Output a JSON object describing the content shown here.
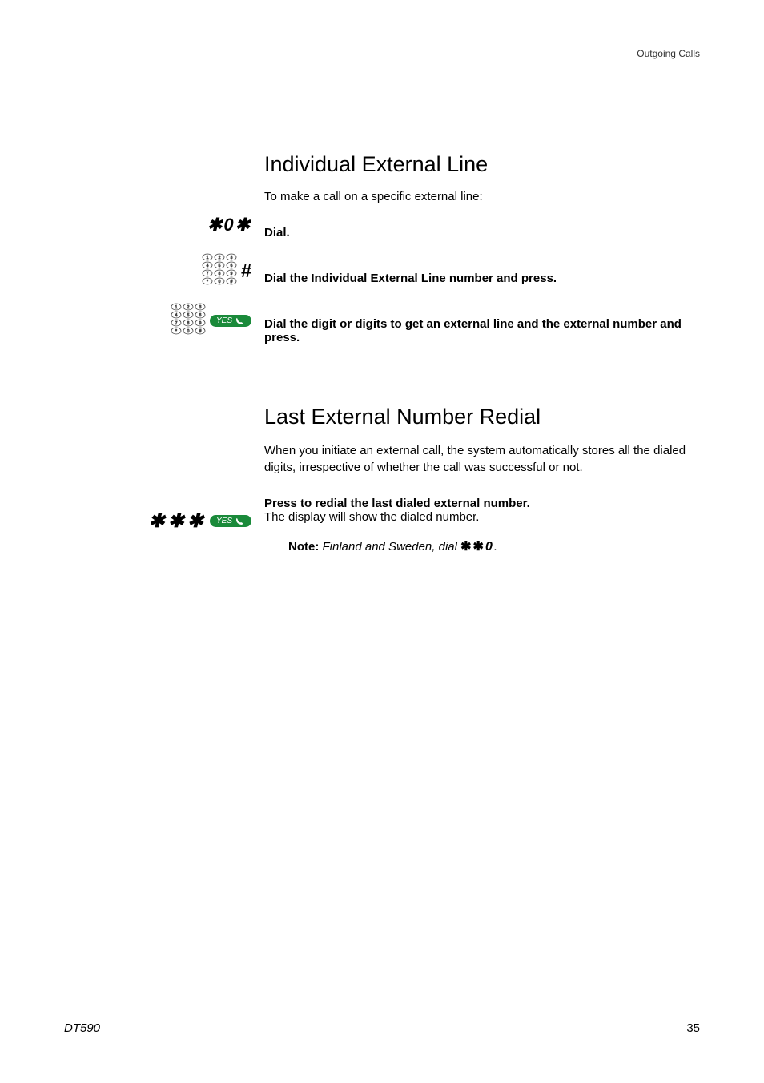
{
  "header": {
    "section_name": "Outgoing Calls"
  },
  "section1": {
    "title": "Individual External Line",
    "intro": "To make a call on a specific external line:",
    "step1": "Dial.",
    "step1_input": "*0*",
    "step2": "Dial the Individual External Line number and press.",
    "step3": "Dial the digit or digits to get an external line and the external number and press."
  },
  "section2": {
    "title": "Last External Number Redial",
    "intro": "When you initiate an external call, the system automatically stores all the dialed digits, irrespective of whether the call was successful or not.",
    "step1_bold": "Press to redial the last dialed external number.",
    "step1_text": "The display will show the dialed number.",
    "step1_input": "***",
    "note_label": "Note:",
    "note_text_before": "Finland and Sweden, dial ",
    "note_code": "**0",
    "note_text_after": "."
  },
  "footer": {
    "model": "DT590",
    "page": "35"
  },
  "icons": {
    "yes_label": "YES"
  }
}
